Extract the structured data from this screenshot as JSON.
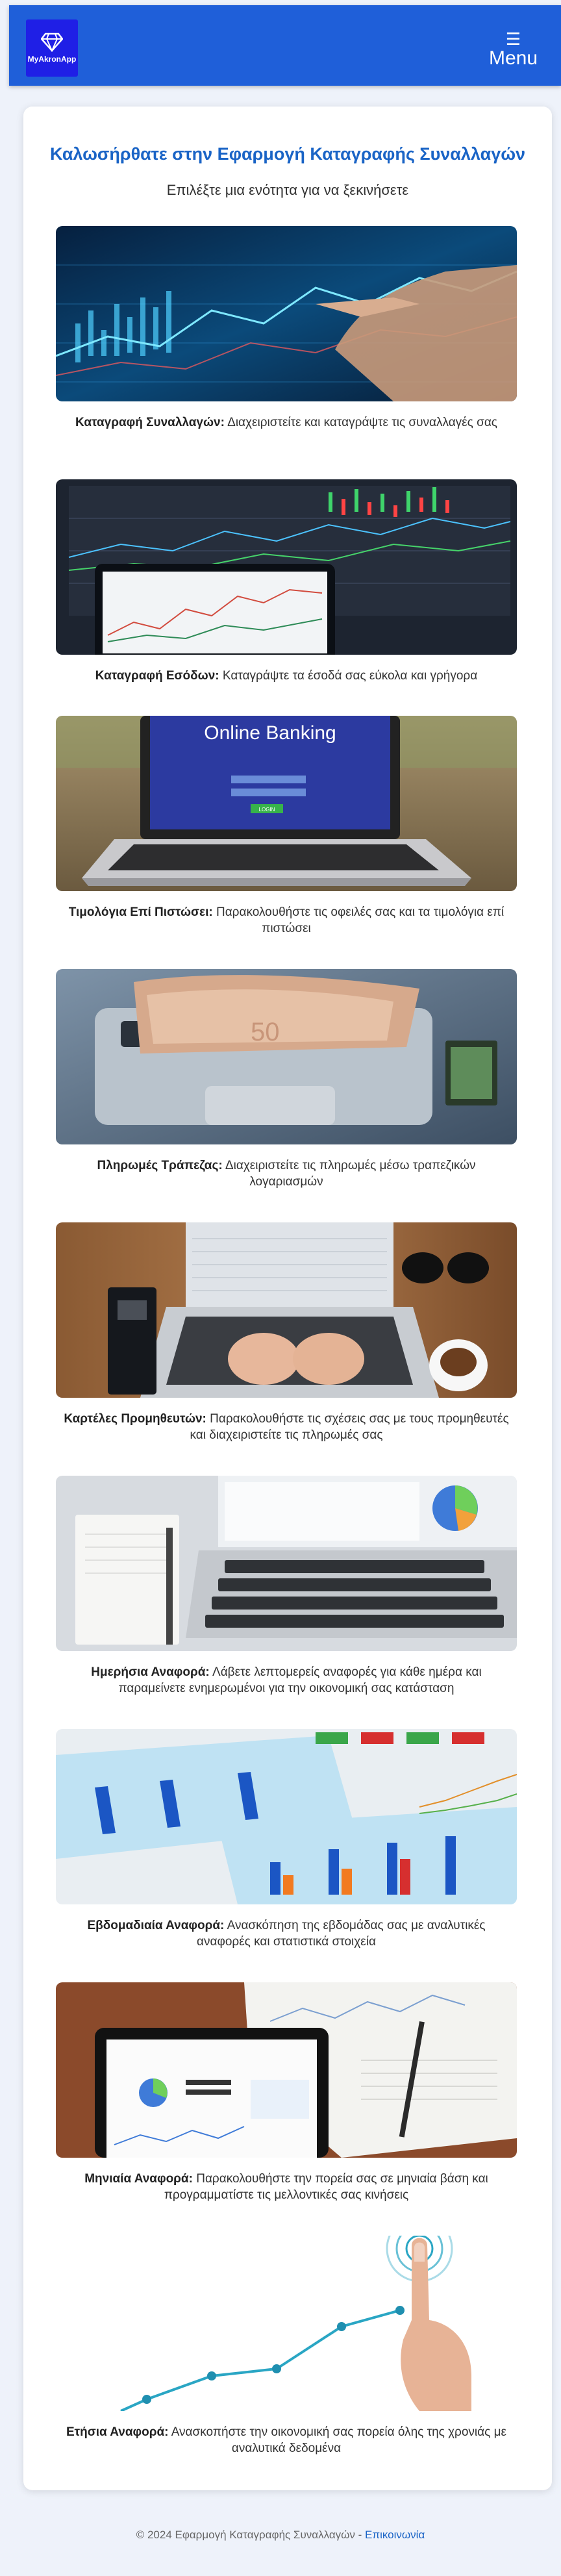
{
  "header": {
    "logo_text": "MyAkronApp",
    "menu_label": "Menu"
  },
  "main": {
    "title": "Καλωσήρθατε στην Εφαρμογή Καταγραφής Συναλλαγών",
    "subtitle": "Επιλέξτε μια ενότητα για να ξεκινήσετε",
    "sections": [
      {
        "name": "Καταγραφή Συναλλαγών:",
        "desc": " Διαχειριστείτε και καταγράψτε τις συναλλαγές σας"
      },
      {
        "name": "Καταγραφή Εσόδων:",
        "desc": " Καταγράψτε τα έσοδά σας εύκολα και γρήγορα"
      },
      {
        "name": "Τιμολόγια Επί Πιστώσει:",
        "desc": " Παρακολουθήστε τις οφειλές σας και τα τιμολόγια επί πιστώσει"
      },
      {
        "name": "Πληρωμές Τράπεζας:",
        "desc": " Διαχειριστείτε τις πληρωμές μέσω τραπεζικών λογαριασμών"
      },
      {
        "name": "Καρτέλες Προμηθευτών:",
        "desc": " Παρακολουθήστε τις σχέσεις σας με τους προμηθευτές και διαχειριστείτε τις πληρωμές σας"
      },
      {
        "name": "Ημερήσια Αναφορά:",
        "desc": " Λάβετε λεπτομερείς αναφορές για κάθε ημέρα και παραμείνετε ενημερωμένοι για την οικονομική σας κατάσταση"
      },
      {
        "name": "Εβδομαδιαία Αναφορά:",
        "desc": " Ανασκόπηση της εβδομάδας σας με αναλυτικές αναφορές και στατιστικά στοιχεία"
      },
      {
        "name": "Μηνιαία Αναφορά:",
        "desc": " Παρακολουθήστε την πορεία σας σε μηνιαία βάση και προγραμματίστε τις μελλοντικές σας κινήσεις"
      },
      {
        "name": "Ετήσια Αναφορά:",
        "desc": " Ανασκοπήστε την οικονομική σας πορεία όλης της χρονιάς με αναλυτικά δεδομένα"
      }
    ],
    "banking_screen_text": "Online Banking",
    "banking_login_button": "LOGIN"
  },
  "footer": {
    "copyright": "© 2024 Εφαρμογή Καταγραφής Συναλλαγών - ",
    "contact_label": "Επικοινωνία"
  }
}
